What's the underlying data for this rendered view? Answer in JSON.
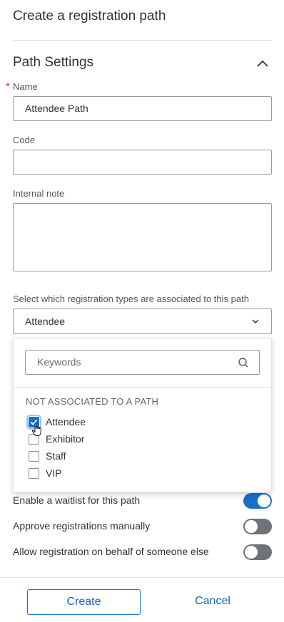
{
  "header": {
    "title": "Create a registration path"
  },
  "section": {
    "title": "Path Settings",
    "collapse_icon": "chevron-up-icon"
  },
  "fields": {
    "name": {
      "label": "Name",
      "required_marker": "*",
      "value": "Attendee Path"
    },
    "code": {
      "label": "Code",
      "value": ""
    },
    "internal_note": {
      "label": "Internal note",
      "value": ""
    }
  },
  "registration_types": {
    "label": "Select which registration types are associated to this path",
    "selected_value": "Attendee",
    "dropdown_icon": "chevron-down-icon",
    "search": {
      "placeholder": "Keywords",
      "icon": "search-icon"
    },
    "group_heading": "NOT ASSOCIATED TO A PATH",
    "options": [
      {
        "label": "Attendee",
        "checked": true
      },
      {
        "label": "Exhibitor",
        "checked": false
      },
      {
        "label": "Staff",
        "checked": false
      },
      {
        "label": "VIP",
        "checked": false
      }
    ]
  },
  "toggles": [
    {
      "label": "Enable a waitlist for this path",
      "on": true
    },
    {
      "label": "Approve registrations manually",
      "on": false
    },
    {
      "label": "Allow registration on behalf of someone else",
      "on": false
    }
  ],
  "footer": {
    "create_label": "Create",
    "cancel_label": "Cancel"
  },
  "colors": {
    "accent": "#1a6fc8",
    "required": "#e0301e",
    "toggle_off": "#6e7279"
  }
}
